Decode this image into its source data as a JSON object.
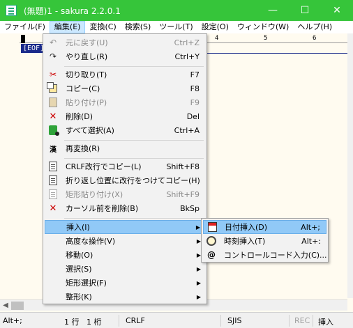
{
  "window": {
    "title": "(無題)1 - sakura 2.2.0.1",
    "minimize_glyph": "—",
    "maximize_glyph": "☐",
    "close_glyph": "✕"
  },
  "menubar": [
    {
      "label": "ファイル(F)"
    },
    {
      "label": "編集(E)"
    },
    {
      "label": "変換(C)"
    },
    {
      "label": "検索(S)"
    },
    {
      "label": "ツール(T)"
    },
    {
      "label": "設定(O)"
    },
    {
      "label": "ウィンドウ(W)"
    },
    {
      "label": "ヘルプ(H)"
    }
  ],
  "editor": {
    "ruler_marks": [
      "4",
      "5",
      "6"
    ],
    "eof": "[EOF]"
  },
  "edit_menu": {
    "items": [
      {
        "label": "元に戻す(U)",
        "shortcut": "Ctrl+Z",
        "icon": "undo-icon",
        "disabled": true
      },
      {
        "label": "やり直し(R)",
        "shortcut": "Ctrl+Y",
        "icon": "redo-icon"
      },
      {
        "label": "切り取り(T)",
        "shortcut": "F7",
        "icon": "scissors-icon"
      },
      {
        "label": "コピー(C)",
        "shortcut": "F8",
        "icon": "copy-icon"
      },
      {
        "label": "貼り付け(P)",
        "shortcut": "F9",
        "icon": "paste-icon",
        "disabled": true
      },
      {
        "label": "削除(D)",
        "shortcut": "Del",
        "icon": "delete-icon"
      },
      {
        "label": "すべて選択(A)",
        "shortcut": "Ctrl+A",
        "icon": "select-all-icon"
      },
      {
        "label": "再変換(R)",
        "shortcut": "",
        "icon": "reconvert-icon"
      },
      {
        "label": "CRLF改行でコピー(L)",
        "shortcut": "Shift+F8",
        "icon": "copy-crlf-icon"
      },
      {
        "label": "折り返し位置に改行をつけてコピー(H)",
        "shortcut": "",
        "icon": "copy-wrap-icon"
      },
      {
        "label": "矩形貼り付け(X)",
        "shortcut": "Shift+F9",
        "icon": "paste-box-icon",
        "disabled": true
      },
      {
        "label": "カーソル前を削除(B)",
        "shortcut": "BkSp",
        "icon": "delete-back-icon"
      },
      {
        "label": "挿入(I)",
        "submenu": true,
        "highlighted": true
      },
      {
        "label": "高度な操作(V)",
        "submenu": true
      },
      {
        "label": "移動(O)",
        "submenu": true
      },
      {
        "label": "選択(S)",
        "submenu": true
      },
      {
        "label": "矩形選択(F)",
        "submenu": true
      },
      {
        "label": "整形(K)",
        "submenu": true
      }
    ]
  },
  "insert_submenu": {
    "items": [
      {
        "label": "日付挿入(D)",
        "shortcut": "Alt+;",
        "icon": "calendar-icon",
        "highlighted": true
      },
      {
        "label": "時刻挿入(T)",
        "shortcut": "Alt+:",
        "icon": "clock-icon"
      },
      {
        "label": "コントロールコード入力(C)...",
        "shortcut": "",
        "icon": "control-code-icon"
      }
    ]
  },
  "statusbar": {
    "shortcut_hint": "Alt+;",
    "line": "1 行",
    "column": "1 桁",
    "newline": "CRLF",
    "encoding": "SJIS",
    "rec": "REC",
    "mode": "挿入"
  }
}
